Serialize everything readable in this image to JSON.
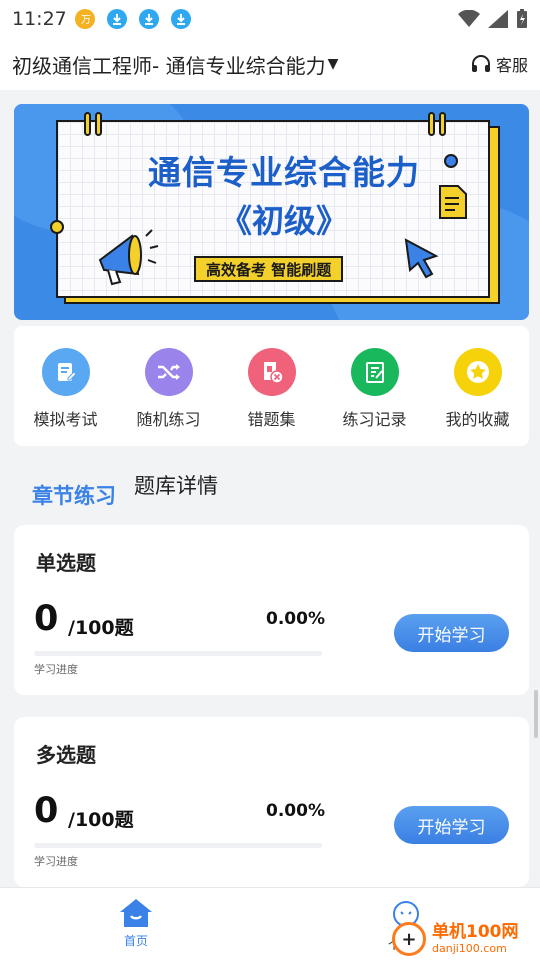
{
  "status_bar": {
    "time": "11:27",
    "notifications": [
      {
        "icon": "app-badge-icon",
        "color": "#f4b223"
      },
      {
        "icon": "download-icon",
        "color": "#2ea8f0"
      },
      {
        "icon": "download-icon",
        "color": "#2ea8f0"
      },
      {
        "icon": "download-icon",
        "color": "#2ea8f0"
      }
    ]
  },
  "header": {
    "title": "初级通信工程师- 通信专业综合能力",
    "caret": "▼",
    "service_label": "客服"
  },
  "banner": {
    "line1": "通信专业综合能力",
    "line2": "《初级》",
    "tag": "高效备考 智能刷题"
  },
  "menu": {
    "items": [
      {
        "label": "模拟考试",
        "icon": "mock-exam-icon",
        "color": "#5aa7f2"
      },
      {
        "label": "随机练习",
        "icon": "shuffle-icon",
        "color": "#9b83ec"
      },
      {
        "label": "错题集",
        "icon": "wrong-questions-icon",
        "color": "#f0627a"
      },
      {
        "label": "练习记录",
        "icon": "practice-record-icon",
        "color": "#19b85c"
      },
      {
        "label": "我的收藏",
        "icon": "star-icon",
        "color": "#f5d20a"
      }
    ]
  },
  "tabs": {
    "active": "章节练习",
    "other": "题库详情"
  },
  "cards": [
    {
      "title": "单选题",
      "count": "0",
      "total": "/100题",
      "percent": "0.00%",
      "progress": 0,
      "progress_label": "学习进度",
      "button": "开始学习"
    },
    {
      "title": "多选题",
      "count": "0",
      "total": "/100题",
      "percent": "0.00%",
      "progress": 0,
      "progress_label": "学习进度",
      "button": "开始学习"
    }
  ],
  "bottom_nav": {
    "home_label": "首页",
    "me_label": "个人中"
  },
  "watermark": {
    "name": "单机100网",
    "url": "danji100.com"
  },
  "colors": {
    "accent": "#3a82e8",
    "banner_bg": "#3b8ae6",
    "banner_title": "#1d5fc9",
    "banner_yellow": "#f3d02a"
  }
}
